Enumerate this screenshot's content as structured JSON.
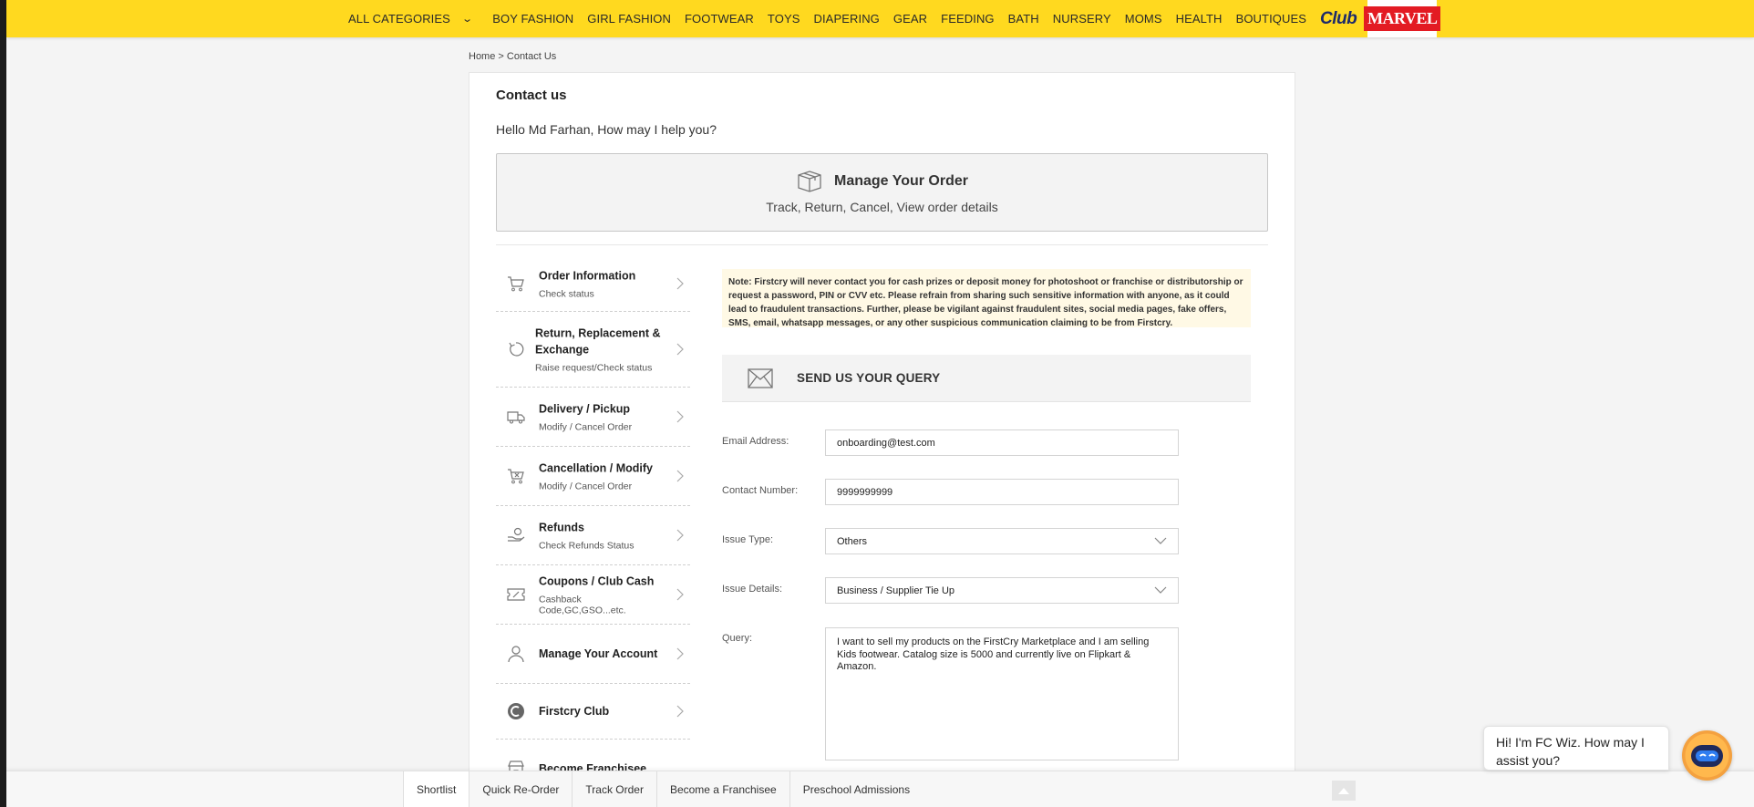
{
  "nav": {
    "all_categories": "ALL CATEGORIES",
    "items": [
      "BOY FASHION",
      "GIRL FASHION",
      "FOOTWEAR",
      "TOYS",
      "DIAPERING",
      "GEAR",
      "FEEDING",
      "BATH",
      "NURSERY",
      "MOMS",
      "HEALTH",
      "BOUTIQUES"
    ],
    "club_logo": "Club",
    "marvel_logo": "MARVEL"
  },
  "breadcrumb": "Home > Contact Us",
  "page": {
    "title": "Contact us",
    "greeting": "Hello Md Farhan, How may I help you?"
  },
  "manage_order": {
    "title": "Manage Your Order",
    "subtitle": "Track, Return, Cancel, View order details"
  },
  "side_menu": [
    {
      "title": "Order Information",
      "subtitle": "Check status",
      "icon": "cart-icon"
    },
    {
      "title": "Return, Replacement & Exchange",
      "subtitle": "Raise request/Check status",
      "icon": "return-icon"
    },
    {
      "title": "Delivery / Pickup",
      "subtitle": "Modify / Cancel Order",
      "icon": "truck-icon"
    },
    {
      "title": "Cancellation / Modify",
      "subtitle": "Modify / Cancel Order",
      "icon": "cart-cancel-icon"
    },
    {
      "title": "Refunds",
      "subtitle": "Check Refunds Status",
      "icon": "refund-icon"
    },
    {
      "title": "Coupons / Club Cash",
      "subtitle": "Cashback Code,GC,GSO...etc.",
      "icon": "coupon-icon"
    },
    {
      "title": "Manage Your Account",
      "subtitle": "",
      "icon": "user-icon"
    },
    {
      "title": "Firstcry Club",
      "subtitle": "",
      "icon": "club-icon"
    },
    {
      "title": "Become Franchisee",
      "subtitle": "",
      "icon": "store-icon"
    }
  ],
  "note": "Note: Firstcry will never contact you for cash prizes or deposit money for photoshoot or franchise or distributorship or request a password, PIN or CVV etc. Please refrain from sharing such sensitive information with anyone, as it could lead to fraudulent transactions. Further, please be vigilant against fraudulent sites, social media pages, fake offers, SMS, email, whatsapp messages, or any other suspicious communication claiming to be from Firstcry.",
  "query_header": "SEND US YOUR QUERY",
  "form": {
    "email_label": "Email Address:",
    "email_value": "onboarding@test.com",
    "contact_label": "Contact Number:",
    "contact_value": "9999999999",
    "issue_type_label": "Issue Type:",
    "issue_type_value": "Others",
    "issue_details_label": "Issue Details:",
    "issue_details_value": "Business / Supplier Tie Up",
    "query_label": "Query:",
    "query_value": "I want to sell my products on the FirstCry Marketplace and I am selling Kids footwear. Catalog size is 5000 and currently live on Flipkart & Amazon."
  },
  "bottom_bar": [
    "Shortlist",
    "Quick Re-Order",
    "Track Order",
    "Become a Franchisee",
    "Preschool Admissions"
  ],
  "chat": {
    "message": "Hi! I'm FC Wiz. How may I assist you?"
  }
}
